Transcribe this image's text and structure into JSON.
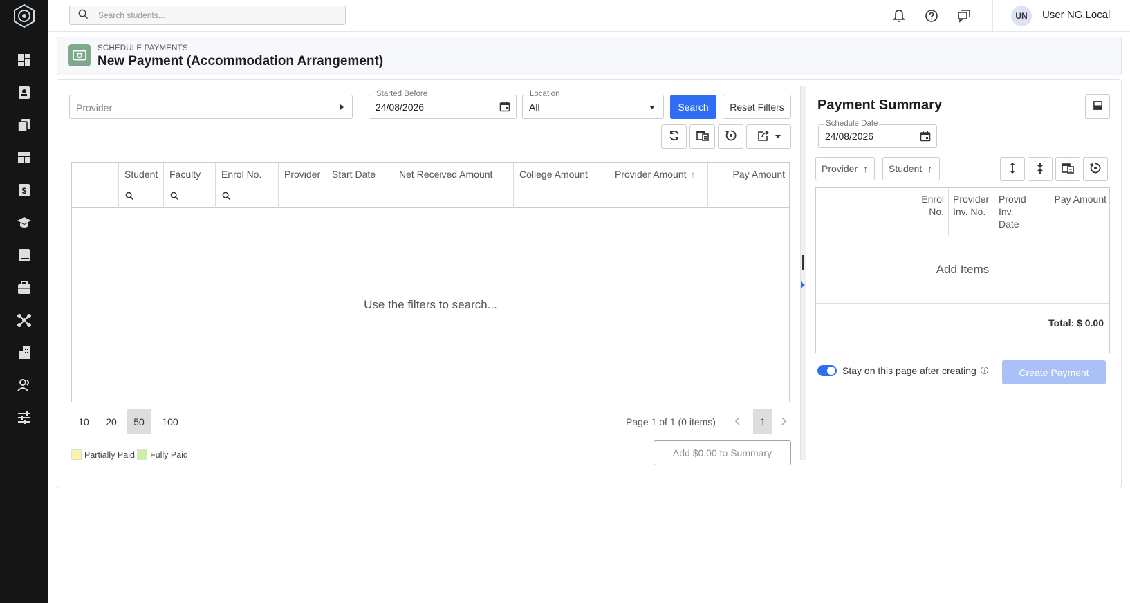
{
  "topbar": {
    "search_placeholder": "Search students...",
    "user_initials": "UN",
    "user_name": "User NG.Local"
  },
  "sidebar": {
    "items": [
      {
        "icon": "dashboard-icon"
      },
      {
        "icon": "contacts-icon"
      },
      {
        "icon": "documents-icon"
      },
      {
        "icon": "layout-icon"
      },
      {
        "icon": "payments-icon"
      },
      {
        "icon": "graduation-cap-icon"
      },
      {
        "icon": "book-icon"
      },
      {
        "icon": "briefcase-icon"
      },
      {
        "icon": "network-icon"
      },
      {
        "icon": "building-icon"
      },
      {
        "icon": "users-icon"
      },
      {
        "icon": "settings-sliders-icon"
      }
    ]
  },
  "header": {
    "section": "SCHEDULE PAYMENTS",
    "title": "New Payment (Accommodation Arrangement)"
  },
  "filters": {
    "provider_placeholder": "Provider",
    "started_before_label": "Started Before",
    "started_before_value": "24/08/2026",
    "location_label": "Location",
    "location_value": "All",
    "search_label": "Search",
    "reset_label": "Reset Filters"
  },
  "grid": {
    "columns": [
      "Student",
      "Faculty",
      "Enrol No.",
      "Provider",
      "Start Date",
      "Net Received Amount",
      "College Amount",
      "Provider Amount",
      "Pay Amount"
    ],
    "sort_mark": "↑",
    "empty_text": "Use the filters to search...",
    "page_sizes": [
      "10",
      "20",
      "50",
      "100"
    ],
    "page_size_selected": "50",
    "page_info": "Page 1 of 1 (0 items)",
    "current_page": "1"
  },
  "legend": {
    "partial_label": "Partially Paid",
    "partial_color": "#fbf3a8",
    "full_label": "Fully Paid",
    "full_color": "#c9f0a3"
  },
  "add_button": "Add $0.00 to Summary",
  "summary": {
    "title": "Payment Summary",
    "schedule_date_label": "Schedule Date",
    "schedule_date_value": "24/08/2026",
    "group_chips": [
      "Provider",
      "Student"
    ],
    "sort_mark": "↑",
    "columns": [
      "Enrol No.",
      "Provider Inv. No.",
      "Provider Inv. Date",
      "Pay Amount"
    ],
    "add_items": "Add Items",
    "total": "Total: $ 0.00",
    "stay_label": "Stay on this page after creating",
    "create_label": "Create Payment"
  },
  "colors": {
    "accent": "#2f6ef2",
    "sidebar_bg": "#151515",
    "create_disabled": "#a9c1f7"
  }
}
